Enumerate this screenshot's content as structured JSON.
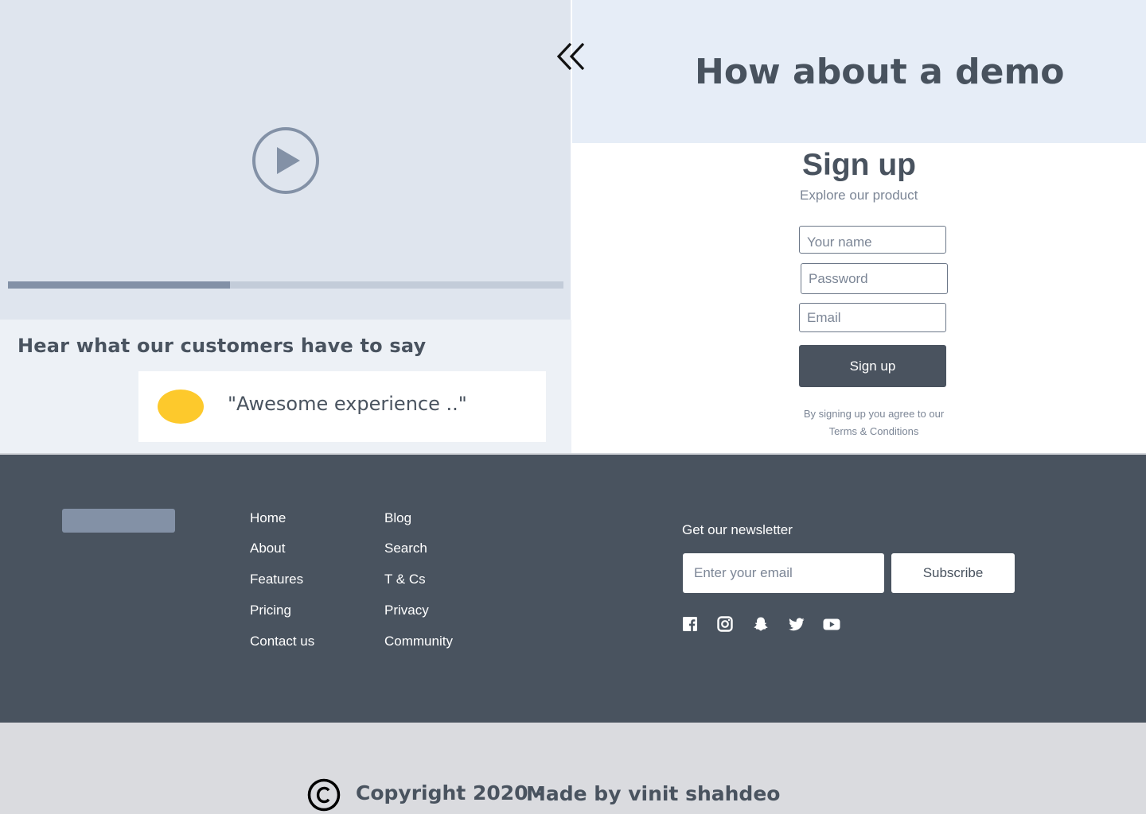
{
  "colors": {
    "dark": "#49535f",
    "muted": "#7c8696",
    "accent_yellow": "#fdc92c",
    "video_bg": "#dfe5ee",
    "banner_bg": "#e6edf7"
  },
  "video": {
    "play_icon": "play-icon",
    "progress": 0.4
  },
  "testimonials": {
    "heading": "Hear what our customers have to say",
    "quote": "\"Awesome experience ..\""
  },
  "demo": {
    "collapse_icon": "double-chevron-left-icon",
    "title": "How about a demo"
  },
  "signup": {
    "title": "Sign up",
    "subtitle": "Explore our product",
    "name_placeholder": "Your name",
    "password_placeholder": "Password",
    "email_placeholder": "Email",
    "button_label": "Sign up",
    "terms_prefix": "By signing up you agree to our",
    "terms_link": "Terms & Conditions"
  },
  "footer": {
    "nav_col_1": [
      "Home",
      "About",
      "Features",
      "Pricing",
      "Contact us"
    ],
    "nav_col_2": [
      "Blog",
      "Search",
      "T & Cs",
      "Privacy",
      "Community"
    ],
    "newsletter_label": "Get our newsletter",
    "newsletter_placeholder": "Enter your email",
    "subscribe_label": "Subscribe",
    "social_icons": [
      "facebook-icon",
      "instagram-icon",
      "snapchat-icon",
      "twitter-icon",
      "youtube-icon"
    ]
  },
  "bottom": {
    "copyright_icon": "copyright-icon",
    "copyright": "Copyright 2020 -",
    "author": "Made by vinit shahdeo"
  }
}
